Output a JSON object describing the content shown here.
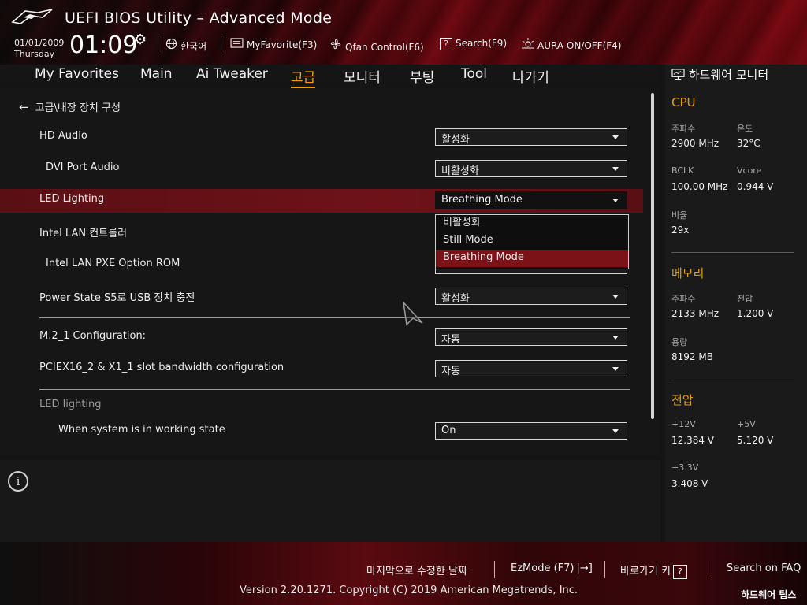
{
  "header": {
    "title": "UEFI BIOS Utility – Advanced Mode",
    "date": "01/01/2009",
    "day": "Thursday",
    "time": "01:09",
    "items": [
      {
        "icon": "globe-icon",
        "label": "한국어"
      },
      {
        "icon": "myfavorite-icon",
        "label": "MyFavorite(F3)"
      },
      {
        "icon": "fan-icon",
        "label": "Qfan Control(F6)"
      },
      {
        "icon": "search-help-icon",
        "label": "Search(F9)"
      },
      {
        "icon": "aura-icon",
        "label": "AURA ON/OFF(F4)"
      }
    ]
  },
  "nav": {
    "tabs": [
      "My Favorites",
      "Main",
      "Ai Tweaker",
      "고급",
      "모니터",
      "부팅",
      "Tool",
      "나가기"
    ],
    "active": "고급"
  },
  "breadcrumb": "고급\\내장 장치 구성",
  "settings": [
    {
      "label": "HD Audio",
      "value": "활성화"
    },
    {
      "label": "DVI Port Audio",
      "value": "비활성화"
    },
    {
      "label": "LED Lighting",
      "value": "Breathing Mode"
    },
    {
      "label": "Intel LAN 컨트롤러",
      "value": ""
    },
    {
      "label": "Intel LAN PXE Option ROM",
      "value": ""
    },
    {
      "label": "Power State S5로 USB 장치 충전",
      "value": "활성화"
    },
    {
      "label": "M.2_1 Configuration:",
      "value": "자동"
    },
    {
      "label": "PCIEX16_2 & X1_1 slot bandwidth configuration",
      "value": "자동"
    },
    {
      "label": "When system is in working state",
      "value": "On"
    }
  ],
  "section_led": "LED lighting",
  "dropdown_options": [
    "비활성화",
    "Still Mode",
    "Breathing Mode"
  ],
  "hw_monitor": {
    "title": "하드웨어 모니터",
    "cpu": {
      "title": "CPU",
      "freq_label": "주파수",
      "freq": "2900 MHz",
      "temp_label": "온도",
      "temp": "32°C",
      "bclk_label": "BCLK",
      "bclk": "100.00 MHz",
      "vcore_label": "Vcore",
      "vcore": "0.944 V",
      "ratio_label": "비율",
      "ratio": "29x"
    },
    "memory": {
      "title": "메모리",
      "freq_label": "주파수",
      "freq": "2133 MHz",
      "volt_label": "전압",
      "volt": "1.200 V",
      "cap_label": "용량",
      "cap": "8192 MB"
    },
    "voltage": {
      "title": "전압",
      "v12_label": "+12V",
      "v12": "12.384 V",
      "v5_label": "+5V",
      "v5": "5.120 V",
      "v33_label": "+3.3V",
      "v33": "3.408 V"
    }
  },
  "footer": {
    "last_change": "마지막으로 수정한 날짜",
    "ezmode": "EzMode (F7)",
    "hotkeys": "바로가기 키",
    "hotkeys_box": "?",
    "faq": "Search on FAQ",
    "copyright": "Version 2.20.1271. Copyright (C) 2019 American Megatrends, Inc.",
    "watermark": "하드웨어 팁스"
  },
  "info_icon_glyph": "i",
  "colors": {
    "accent": "#f0a000",
    "highlight_row": "#6e1218",
    "brand_red": "#8a0c14"
  }
}
